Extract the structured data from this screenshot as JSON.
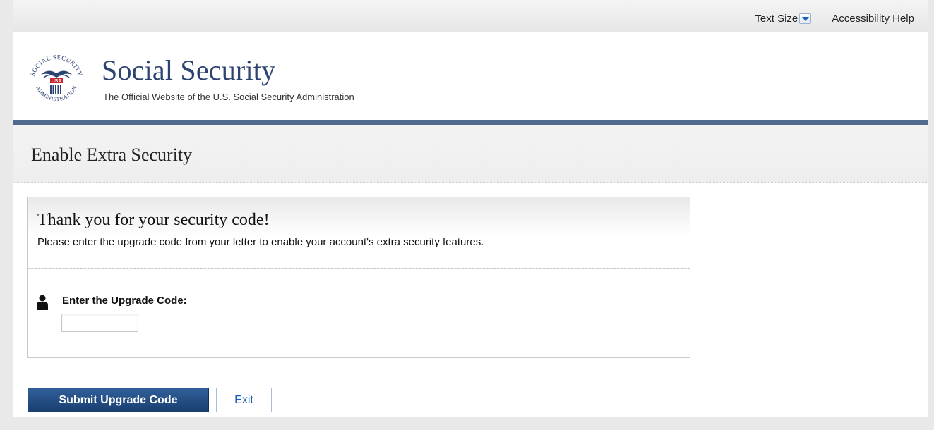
{
  "utility": {
    "text_size_label": "Text Size",
    "accessibility_help": "Accessibility Help"
  },
  "header": {
    "site_title": "Social Security",
    "site_subtitle": "The Official Website of the U.S. Social Security Administration",
    "logo": {
      "top_text": "SOCIAL SECURITY",
      "bottom_text": "ADMINISTRATION",
      "badge": "USA"
    }
  },
  "page": {
    "title": "Enable Extra Security"
  },
  "panel": {
    "heading": "Thank you for your security code!",
    "description": "Please enter the upgrade code from your letter to enable your account's extra security features.",
    "field_label": "Enter the Upgrade Code:",
    "field_value": ""
  },
  "actions": {
    "submit_label": "Submit Upgrade Code",
    "exit_label": "Exit"
  },
  "colors": {
    "brand_navy": "#2c4270",
    "header_rule": "#506a8f",
    "button_primary": "#1a3f70",
    "link_blue": "#1a5fb4"
  }
}
